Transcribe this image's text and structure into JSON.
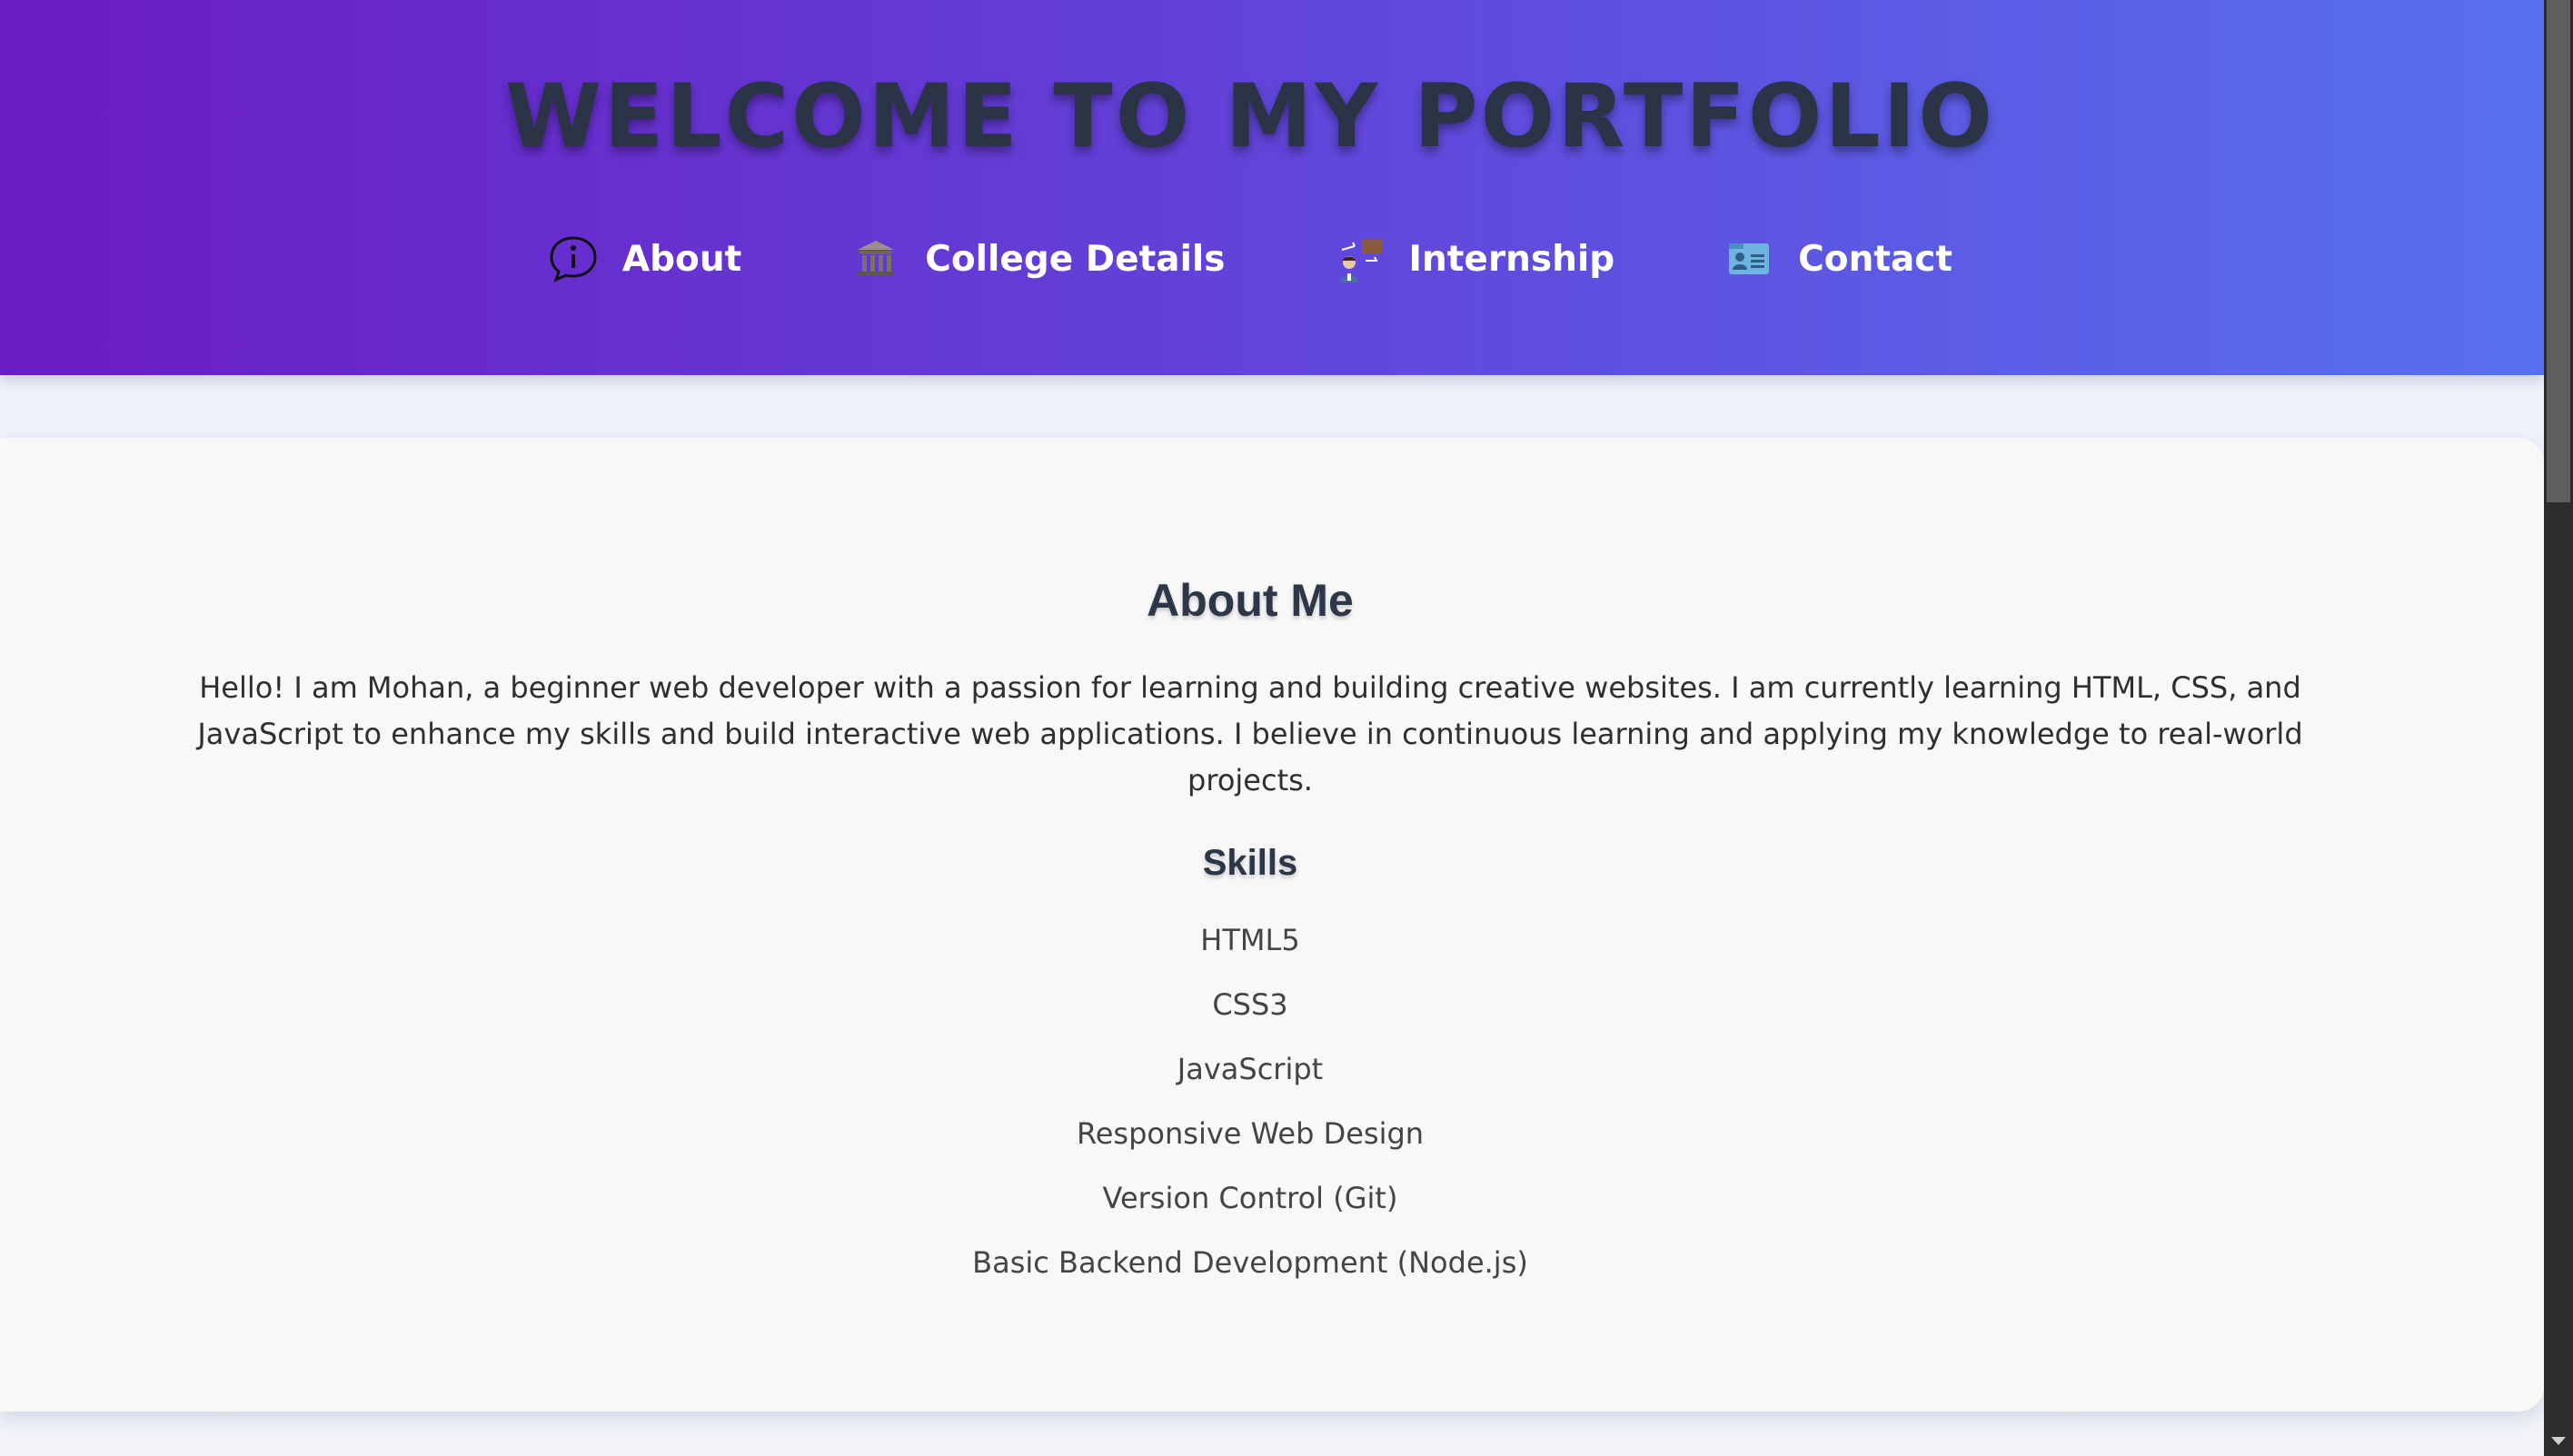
{
  "header": {
    "title": "WELCOME TO MY PORTFOLIO",
    "nav": [
      {
        "label": "About",
        "icon": "info-speech-bubble-icon"
      },
      {
        "label": "College Details",
        "icon": "college-building-icon"
      },
      {
        "label": "Internship",
        "icon": "internship-presenter-icon"
      },
      {
        "label": "Contact",
        "icon": "contact-card-icon"
      }
    ]
  },
  "about": {
    "title": "About Me",
    "text": "Hello! I am Mohan, a beginner web developer with a passion for learning and building creative websites. I am currently learning HTML, CSS, and JavaScript to enhance my skills and build interactive web applications. I believe in continuous learning and applying my knowledge to real-world projects.",
    "skills_title": "Skills",
    "skills": [
      "HTML5",
      "CSS3",
      "JavaScript",
      "Responsive Web Design",
      "Version Control (Git)",
      "Basic Backend Development (Node.js)"
    ]
  },
  "colors": {
    "header_gradient_start": "#6b1cc4",
    "header_gradient_end": "#5770ee",
    "title_text": "#2b3447",
    "nav_text": "#ffffff",
    "card_background": "#f8f8f8"
  }
}
